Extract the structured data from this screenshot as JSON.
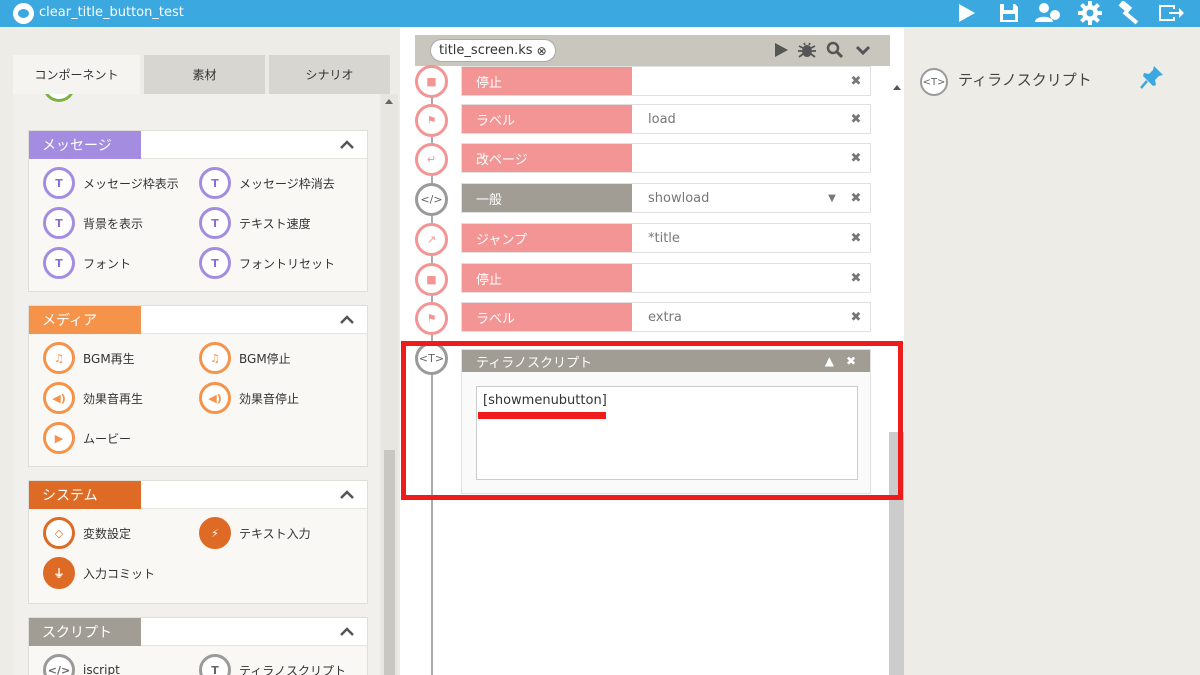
{
  "window": {
    "title": "clear_title_button_test"
  },
  "toolbar": {
    "icons": [
      "play-icon",
      "save-icon",
      "users-icon",
      "gear-icon",
      "hammer-icon",
      "export-icon"
    ]
  },
  "left": {
    "tabs": [
      "コンポーネント",
      "素材",
      "シナリオ"
    ],
    "groups": [
      {
        "name": "メッセージ",
        "color": "#a48de0",
        "items": [
          "メッセージ枠表示",
          "メッセージ枠消去",
          "背景を表示",
          "テキスト速度",
          "フォント",
          "フォントリセット"
        ]
      },
      {
        "name": "メディア",
        "color": "#f6934a",
        "items": [
          "BGM再生",
          "BGM停止",
          "効果音再生",
          "効果音停止",
          "ムービー"
        ]
      },
      {
        "name": "システム",
        "color": "#de6b25",
        "items": [
          "変数設定",
          "テキスト入力",
          "入力コミット"
        ]
      },
      {
        "name": "スクリプト",
        "color": "#a19d94",
        "items": [
          "iscript",
          "ティラノスクリプト"
        ]
      }
    ]
  },
  "editor": {
    "file_tab": "title_screen.ks",
    "rows": [
      {
        "label": "停止",
        "value": ""
      },
      {
        "label": "ラベル",
        "value": "load"
      },
      {
        "label": "改ページ",
        "value": ""
      },
      {
        "label": "一般",
        "value": "showload"
      },
      {
        "label": "ジャンプ",
        "value": "*title"
      },
      {
        "label": "停止",
        "value": ""
      },
      {
        "label": "ラベル",
        "value": "extra"
      }
    ],
    "script_block": {
      "title": "ティラノスクリプト",
      "content": "[showmenubutton]",
      "node_label": "<T>"
    },
    "colors": {
      "pink": "#f39595",
      "gray": "#a19d94",
      "highlight": "#ef1c1c"
    }
  },
  "right": {
    "label": "ティラノスクリプト",
    "node_label": "<T>"
  }
}
